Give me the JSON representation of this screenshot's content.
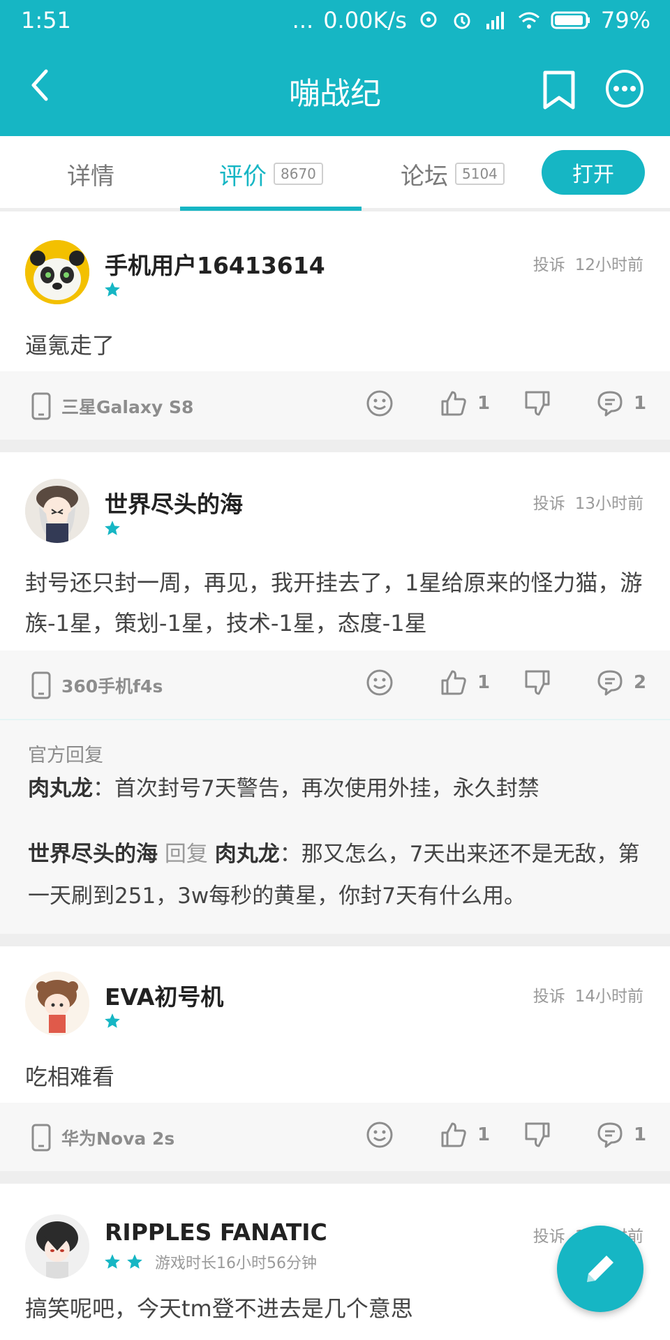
{
  "status_bar": {
    "time": "1:51",
    "dots": "...",
    "net_speed": "0.00K/s",
    "battery": "79%"
  },
  "header": {
    "title": "嘣战纪",
    "accent_color": "#16b6c4"
  },
  "tabs": [
    {
      "label": "详情"
    },
    {
      "label": "评价",
      "count": "8670"
    },
    {
      "label": "论坛",
      "count": "5104"
    }
  ],
  "open_button": "打开",
  "reviews": [
    {
      "username": "手机用户16413614",
      "stars": 1,
      "report": "投诉",
      "time": "12小时前",
      "content": "逼氪走了",
      "device": "三星Galaxy S8",
      "likes": "1",
      "comments": "1"
    },
    {
      "username": "世界尽头的海",
      "stars": 1,
      "report": "投诉",
      "time": "13小时前",
      "content": "封号还只封一周，再见，我开挂去了，1星给原来的怪力猫，游族-1星，策划-1星，技术-1星，态度-1星",
      "device": "360手机f4s",
      "likes": "1",
      "comments": "2",
      "official_reply": {
        "title": "官方回复",
        "author": "肉丸龙",
        "text": "：首次封号7天警告，再次使用外挂，永久封禁"
      },
      "user_reply": {
        "author": "世界尽头的海",
        "reply_word": "回复",
        "target": "肉丸龙",
        "text": "：那又怎么，7天出来还不是无敌，第一天刷到251，3w每秒的黄星，你封7天有什么用。"
      }
    },
    {
      "username": "EVA初号机",
      "stars": 1,
      "report": "投诉",
      "time": "14小时前",
      "content": "吃相难看",
      "device": "华为Nova 2s",
      "likes": "1",
      "comments": "1"
    },
    {
      "username": "RIPPLES FANATIC",
      "stars": 2,
      "playtime": "游戏时长16小时56分钟",
      "report": "投诉",
      "time": "14小时前",
      "content": "搞笑呢吧，今天tm登不进去是几个意思"
    }
  ]
}
